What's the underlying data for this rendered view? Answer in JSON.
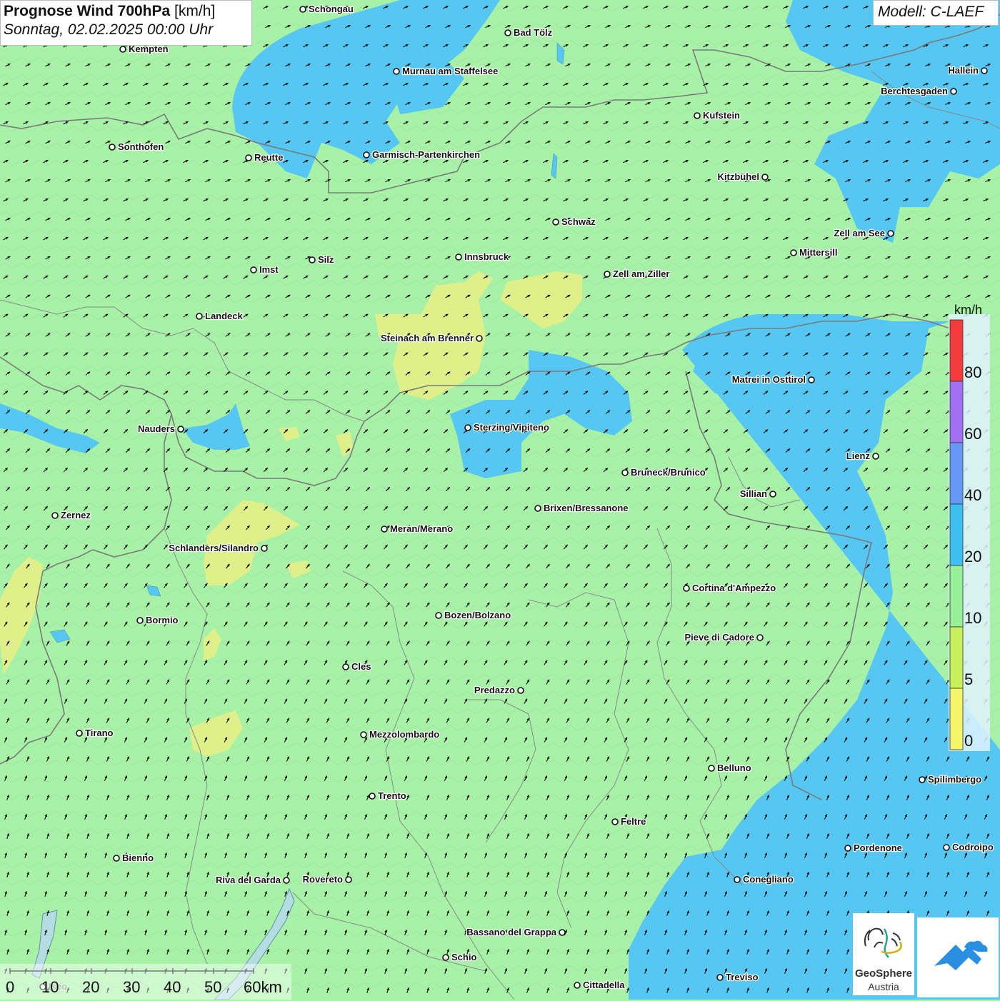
{
  "header": {
    "title_bold": "Prognose Wind 700hPa",
    "title_unit": "[km/h]",
    "date": "Sonntag, 02.02.2025 00:00 Uhr"
  },
  "model_label": "Modell: C-LAEF",
  "legend": {
    "unit": "km/h",
    "ticks": [
      "80",
      "60",
      "40",
      "20",
      "10",
      "5",
      "0"
    ],
    "colors": [
      "#f53b3b",
      "#a070f0",
      "#6699f5",
      "#3dbfef",
      "#97ef97",
      "#c8f05a",
      "#f5f56a"
    ]
  },
  "scale_bar": {
    "labels": [
      "0",
      "10",
      "20",
      "30",
      "40",
      "50",
      "60km"
    ]
  },
  "colors": {
    "background_green": "#a7f2a7",
    "wind_blue": "#55c7f2",
    "calm_yellow": "#dff08a",
    "border_gray": "#777777"
  },
  "cities": [
    {
      "name": "Schongau"
    },
    {
      "name": "Bad Tölz"
    },
    {
      "name": "Kempten"
    },
    {
      "name": "Murnau am Staffelsee"
    },
    {
      "name": "Hallein"
    },
    {
      "name": "Berchtesgaden"
    },
    {
      "name": "Kufstein"
    },
    {
      "name": "Sonthofen"
    },
    {
      "name": "Reutte"
    },
    {
      "name": "Garmisch-Partenkirchen"
    },
    {
      "name": "Kitzbühel"
    },
    {
      "name": "Schwaz"
    },
    {
      "name": "Zell am See"
    },
    {
      "name": "Mittersill"
    },
    {
      "name": "Imst"
    },
    {
      "name": "Silz"
    },
    {
      "name": "Innsbruck"
    },
    {
      "name": "Zell am Ziller"
    },
    {
      "name": "Landeck"
    },
    {
      "name": "Steinach am Brenner"
    },
    {
      "name": "Matrei in Osttirol"
    },
    {
      "name": "Nauders"
    },
    {
      "name": "Sterzing/Vipiteno"
    },
    {
      "name": "Lienz"
    },
    {
      "name": "Bruneck/Brunico"
    },
    {
      "name": "Sillian"
    },
    {
      "name": "Zernez"
    },
    {
      "name": "Brixen/Bressanone"
    },
    {
      "name": "Meran/Merano"
    },
    {
      "name": "Schlanders/Silandro"
    },
    {
      "name": "Cortina d'Ampezzo"
    },
    {
      "name": "Bozen/Bolzano"
    },
    {
      "name": "Bormio"
    },
    {
      "name": "Pieve di Cadore"
    },
    {
      "name": "Cles"
    },
    {
      "name": "Predazzo"
    },
    {
      "name": "Tirano"
    },
    {
      "name": "Mezzolombardo"
    },
    {
      "name": "Belluno"
    },
    {
      "name": "Spilimbergo"
    },
    {
      "name": "Trento"
    },
    {
      "name": "Feltre"
    },
    {
      "name": "Pordenone"
    },
    {
      "name": "Codroipo"
    },
    {
      "name": "Bienno"
    },
    {
      "name": "Riva del Garda"
    },
    {
      "name": "Rovereto"
    },
    {
      "name": "Conegliano"
    },
    {
      "name": "Bassano del Grappa"
    },
    {
      "name": "Schio"
    },
    {
      "name": "Treviso"
    },
    {
      "name": "Cittadella"
    },
    {
      "name": "Iseo"
    }
  ],
  "logo": {
    "line1": "GeoSphere",
    "line2": "Austria",
    "icon": "geosphere-logo-icon"
  },
  "second_logo_icon": "mountain-cloud-icon"
}
